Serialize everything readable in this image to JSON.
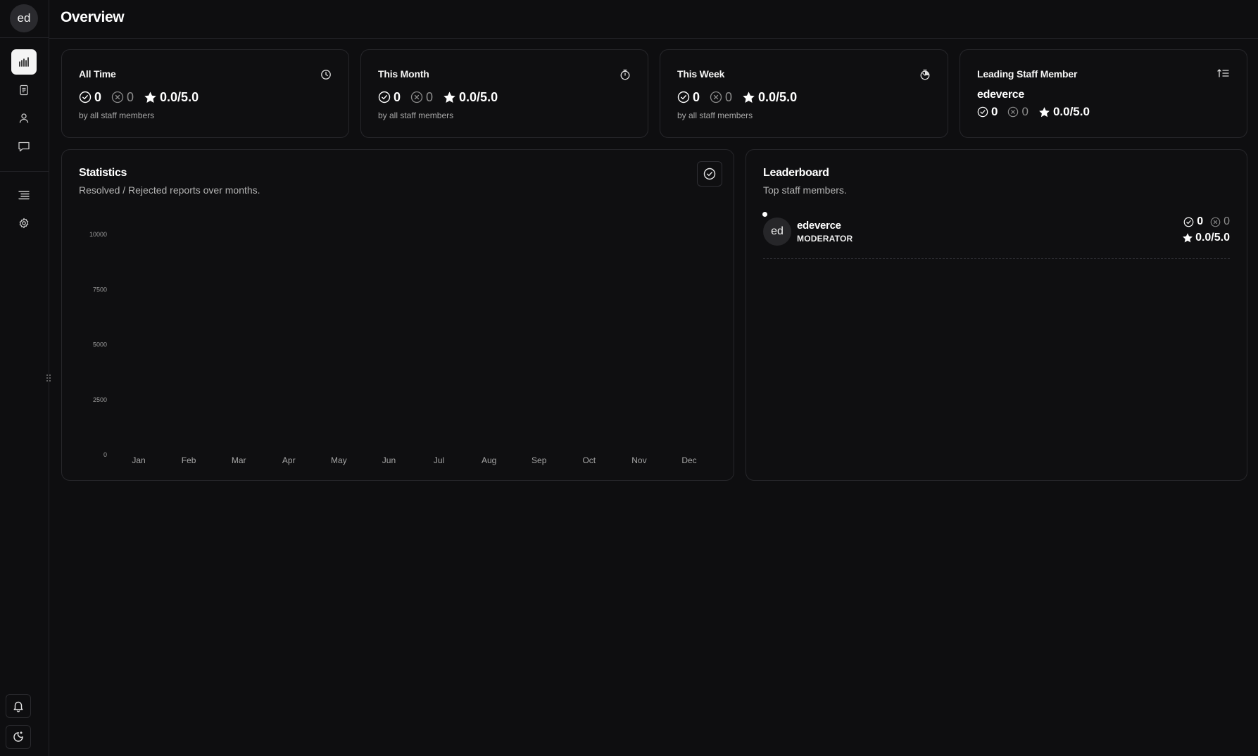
{
  "user": {
    "initials": "ed"
  },
  "page": {
    "title": "Overview"
  },
  "sidebar": {
    "items": [
      {
        "name": "statistics",
        "icon": "bar-chart-icon",
        "active": true
      },
      {
        "name": "reports",
        "icon": "document-icon",
        "active": false
      },
      {
        "name": "users",
        "icon": "user-icon",
        "active": false
      },
      {
        "name": "messages",
        "icon": "chat-icon",
        "active": false
      },
      {
        "name": "logs",
        "icon": "list-icon",
        "active": false
      },
      {
        "name": "settings",
        "icon": "gear-icon",
        "active": false
      }
    ],
    "bottom": [
      {
        "name": "notifications",
        "icon": "bell-icon"
      },
      {
        "name": "theme",
        "icon": "theme-toggle-icon"
      }
    ]
  },
  "cards": {
    "all_time": {
      "title": "All Time",
      "icon": "clock-icon",
      "resolved": "0",
      "rejected": "0",
      "rating": "0.0/5.0",
      "sub": "by all staff members"
    },
    "this_month": {
      "title": "This Month",
      "icon": "stopwatch-icon",
      "resolved": "0",
      "rejected": "0",
      "rating": "0.0/5.0",
      "sub": "by all staff members"
    },
    "this_week": {
      "title": "This Week",
      "icon": "timer-icon",
      "resolved": "0",
      "rejected": "0",
      "rating": "0.0/5.0",
      "sub": "by all staff members"
    },
    "leading": {
      "title": "Leading Staff Member",
      "icon": "sort-icon",
      "name": "edeverce",
      "resolved": "0",
      "rejected": "0",
      "rating": "0.0/5.0"
    }
  },
  "statistics": {
    "title": "Statistics",
    "subtitle": "Resolved / Rejected reports over months.",
    "button_icon": "check-circle-icon"
  },
  "chart_data": {
    "type": "bar",
    "categories": [
      "Jan",
      "Feb",
      "Mar",
      "Apr",
      "May",
      "Jun",
      "Jul",
      "Aug",
      "Sep",
      "Oct",
      "Nov",
      "Dec"
    ],
    "y_ticks": [
      "10000",
      "7500",
      "5000",
      "2500",
      "0"
    ],
    "ylim": [
      0,
      10000
    ],
    "series": [],
    "title": "",
    "xlabel": "",
    "ylabel": ""
  },
  "leaderboard": {
    "title": "Leaderboard",
    "subtitle": "Top staff members.",
    "entries": [
      {
        "initials": "ed",
        "name": "edeverce",
        "role": "MODERATOR",
        "resolved": "0",
        "rejected": "0",
        "rating": "0.0/5.0"
      }
    ]
  }
}
